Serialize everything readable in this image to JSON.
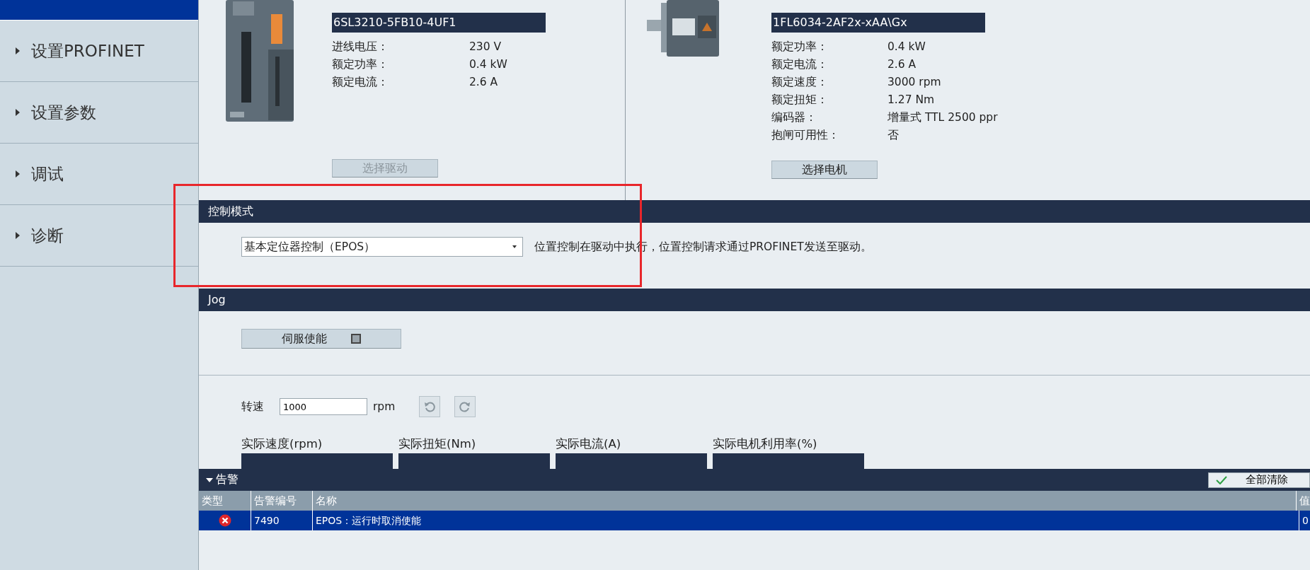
{
  "sidebar": {
    "items": [
      {
        "label": "设置PROFINET",
        "selected": false
      },
      {
        "label": "设置参数",
        "selected": false
      },
      {
        "label": "调试",
        "selected": false
      },
      {
        "label": "诊断",
        "selected": false
      }
    ]
  },
  "drive": {
    "part_number": "6SL3210-5FB10-4UF1",
    "specs": [
      {
        "label": "进线电压：",
        "value": "230 V"
      },
      {
        "label": "额定功率：",
        "value": "0.4 kW"
      },
      {
        "label": "额定电流：",
        "value": "2.6 A"
      }
    ],
    "button": {
      "label": "选择驱动",
      "disabled": true
    }
  },
  "motor": {
    "part_number": "1FL6034-2AF2x-xAA\\Gx",
    "specs": [
      {
        "label": "额定功率：",
        "value": "0.4 kW"
      },
      {
        "label": "额定电流：",
        "value": "2.6 A"
      },
      {
        "label": "额定速度：",
        "value": "3000 rpm"
      },
      {
        "label": "额定扭矩：",
        "value": "1.27 Nm"
      },
      {
        "label": "编码器：",
        "value": "增量式 TTL 2500 ppr"
      },
      {
        "label": "抱闸可用性：",
        "value": "否"
      }
    ],
    "button": {
      "label": "选择电机",
      "disabled": false
    }
  },
  "control_mode": {
    "title": "控制模式",
    "value": "基本定位器控制（EPOS）",
    "description": "位置控制在驱动中执行，位置控制请求通过PROFINET发送至驱动。"
  },
  "jog": {
    "title": "Jog",
    "servo_enable": {
      "label": "伺服使能",
      "checked": false
    },
    "speed": {
      "label": "转速",
      "value": "1000",
      "unit": "rpm"
    },
    "measurements": [
      "实际速度(rpm)",
      "实际扭矩(Nm)",
      "实际电流(A)",
      "实际电机利用率(%)"
    ]
  },
  "alarms": {
    "title": "告警",
    "clear_all": "全部清除",
    "columns": [
      "类型",
      "告警编号",
      "名称",
      "值"
    ],
    "rows": [
      {
        "kind": "error",
        "number": "7490",
        "name": "EPOS：运行时取消使能",
        "value": "0",
        "selected": true
      }
    ]
  }
}
